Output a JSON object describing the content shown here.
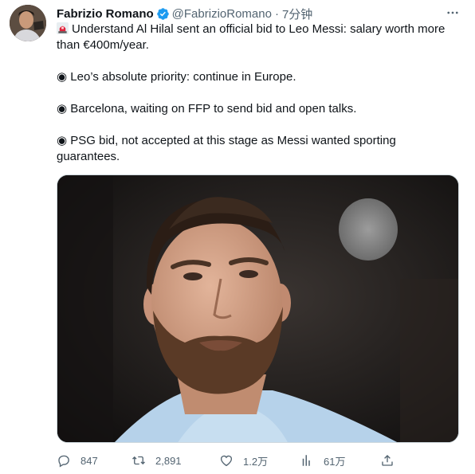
{
  "author": {
    "name": "Fabrizio Romano",
    "handle": "@FabrizioRomano",
    "separator": "·",
    "time": "7分钟"
  },
  "tweet": {
    "line1": "Understand Al Hilal sent an official bid to Leo Messi: salary worth more than €400m/year.",
    "line2": "◉ Leo’s absolute priority: continue in Europe.",
    "line3": "◉ Barcelona, waiting on FFP to send bid and open talks.",
    "line4": "◉ PSG bid, not accepted at this stage as Messi wanted sporting guarantees."
  },
  "actions": {
    "replies": "847",
    "retweets": "2,891",
    "likes": "1.2万",
    "views": "61万"
  },
  "icons": [
    "verified-badge-icon",
    "siren-icon",
    "more-icon",
    "reply-icon",
    "retweet-icon",
    "like-icon",
    "views-icon",
    "share-icon"
  ],
  "colors": {
    "verified": "#1d9bf0",
    "muted": "#536471",
    "text": "#0f1419"
  }
}
